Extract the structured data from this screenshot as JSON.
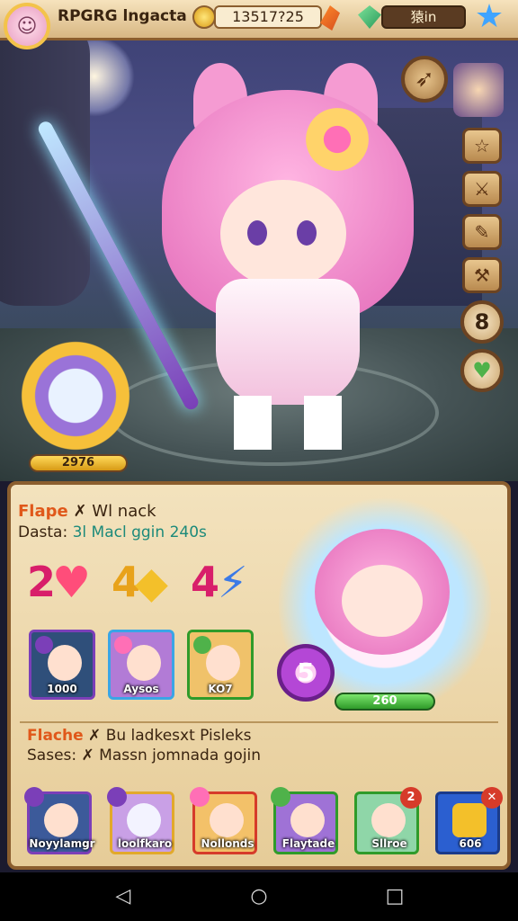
{
  "header": {
    "player_name": "RPGRG lngacta",
    "gold": "13517?25",
    "gems": "猿in"
  },
  "side_menu": {
    "counter": "8"
  },
  "ally": {
    "power": "2976"
  },
  "panel": {
    "row1_label": "Flape",
    "row1_value": "Wl nack",
    "row2_label": "Dasta:",
    "row2_value": "3l Macl ggin 240s",
    "stats": [
      {
        "value": "2",
        "color": "#d81e6a"
      },
      {
        "value": "4",
        "color": "#e8a21a"
      },
      {
        "value": "4",
        "color": "#d81e6a"
      }
    ],
    "cards": [
      {
        "label": "1000",
        "border": "#7b3fb8",
        "bg": "#2f4f7a"
      },
      {
        "label": "Aysos",
        "border": "#3aa5e6",
        "bg": "#b27bd6"
      },
      {
        "label": "KO7",
        "border": "#2f9b2a",
        "bg": "#f0c26a"
      }
    ],
    "orb_label": "5",
    "preview_power": "260",
    "row3_label": "Flache",
    "row3_value": "Bu ladkesxt Pisleks",
    "row4_label": "Sases:",
    "row4_value": "Massn jomnada gojin"
  },
  "team": [
    {
      "label": "Noyylamgr",
      "border": "#7b3fb8",
      "bg": "#3c5a9a"
    },
    {
      "label": "loolfkaro",
      "border": "#e2a92a",
      "bg": "#c9a0e6"
    },
    {
      "label": "Nollonds",
      "border": "#d63b2a",
      "bg": "#f3c169"
    },
    {
      "label": "Flaytade",
      "border": "#2f9b2a",
      "bg": "#9f72d6"
    },
    {
      "label": "Sllroe",
      "border": "#2f9b2a",
      "bg": "#8fd6a8"
    },
    {
      "label": "606",
      "border": "#1a3a8a",
      "bg": "#2b5fd0"
    }
  ],
  "team_badge": "2",
  "colors": {
    "accent_orange": "#e0581a",
    "teal_text": "#1c8a7a",
    "frame_brown": "#8b5e2e"
  },
  "icons": {
    "gold": "gold-coin-icon",
    "gem": "green-gem-icon",
    "star": "star-icon"
  }
}
